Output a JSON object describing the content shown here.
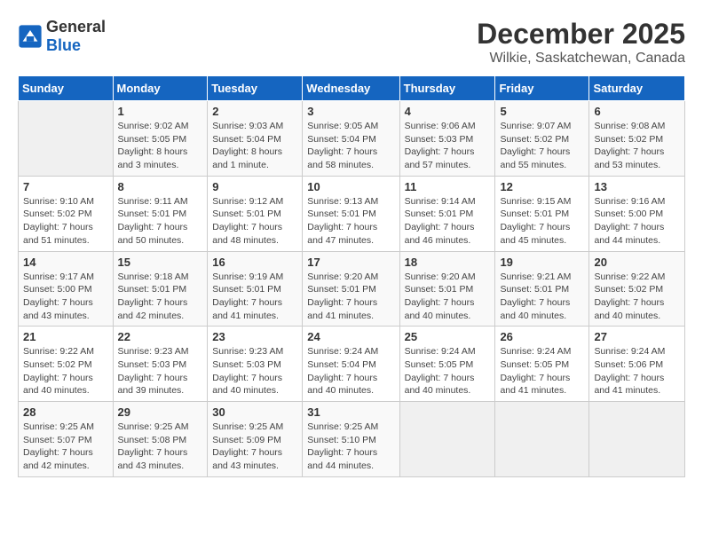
{
  "header": {
    "logo_general": "General",
    "logo_blue": "Blue",
    "month": "December 2025",
    "location": "Wilkie, Saskatchewan, Canada"
  },
  "days_of_week": [
    "Sunday",
    "Monday",
    "Tuesday",
    "Wednesday",
    "Thursday",
    "Friday",
    "Saturday"
  ],
  "weeks": [
    [
      {
        "day": "",
        "info": ""
      },
      {
        "day": "1",
        "info": "Sunrise: 9:02 AM\nSunset: 5:05 PM\nDaylight: 8 hours\nand 3 minutes."
      },
      {
        "day": "2",
        "info": "Sunrise: 9:03 AM\nSunset: 5:04 PM\nDaylight: 8 hours\nand 1 minute."
      },
      {
        "day": "3",
        "info": "Sunrise: 9:05 AM\nSunset: 5:04 PM\nDaylight: 7 hours\nand 58 minutes."
      },
      {
        "day": "4",
        "info": "Sunrise: 9:06 AM\nSunset: 5:03 PM\nDaylight: 7 hours\nand 57 minutes."
      },
      {
        "day": "5",
        "info": "Sunrise: 9:07 AM\nSunset: 5:02 PM\nDaylight: 7 hours\nand 55 minutes."
      },
      {
        "day": "6",
        "info": "Sunrise: 9:08 AM\nSunset: 5:02 PM\nDaylight: 7 hours\nand 53 minutes."
      }
    ],
    [
      {
        "day": "7",
        "info": "Sunrise: 9:10 AM\nSunset: 5:02 PM\nDaylight: 7 hours\nand 51 minutes."
      },
      {
        "day": "8",
        "info": "Sunrise: 9:11 AM\nSunset: 5:01 PM\nDaylight: 7 hours\nand 50 minutes."
      },
      {
        "day": "9",
        "info": "Sunrise: 9:12 AM\nSunset: 5:01 PM\nDaylight: 7 hours\nand 48 minutes."
      },
      {
        "day": "10",
        "info": "Sunrise: 9:13 AM\nSunset: 5:01 PM\nDaylight: 7 hours\nand 47 minutes."
      },
      {
        "day": "11",
        "info": "Sunrise: 9:14 AM\nSunset: 5:01 PM\nDaylight: 7 hours\nand 46 minutes."
      },
      {
        "day": "12",
        "info": "Sunrise: 9:15 AM\nSunset: 5:01 PM\nDaylight: 7 hours\nand 45 minutes."
      },
      {
        "day": "13",
        "info": "Sunrise: 9:16 AM\nSunset: 5:00 PM\nDaylight: 7 hours\nand 44 minutes."
      }
    ],
    [
      {
        "day": "14",
        "info": "Sunrise: 9:17 AM\nSunset: 5:00 PM\nDaylight: 7 hours\nand 43 minutes."
      },
      {
        "day": "15",
        "info": "Sunrise: 9:18 AM\nSunset: 5:01 PM\nDaylight: 7 hours\nand 42 minutes."
      },
      {
        "day": "16",
        "info": "Sunrise: 9:19 AM\nSunset: 5:01 PM\nDaylight: 7 hours\nand 41 minutes."
      },
      {
        "day": "17",
        "info": "Sunrise: 9:20 AM\nSunset: 5:01 PM\nDaylight: 7 hours\nand 41 minutes."
      },
      {
        "day": "18",
        "info": "Sunrise: 9:20 AM\nSunset: 5:01 PM\nDaylight: 7 hours\nand 40 minutes."
      },
      {
        "day": "19",
        "info": "Sunrise: 9:21 AM\nSunset: 5:01 PM\nDaylight: 7 hours\nand 40 minutes."
      },
      {
        "day": "20",
        "info": "Sunrise: 9:22 AM\nSunset: 5:02 PM\nDaylight: 7 hours\nand 40 minutes."
      }
    ],
    [
      {
        "day": "21",
        "info": "Sunrise: 9:22 AM\nSunset: 5:02 PM\nDaylight: 7 hours\nand 40 minutes."
      },
      {
        "day": "22",
        "info": "Sunrise: 9:23 AM\nSunset: 5:03 PM\nDaylight: 7 hours\nand 39 minutes."
      },
      {
        "day": "23",
        "info": "Sunrise: 9:23 AM\nSunset: 5:03 PM\nDaylight: 7 hours\nand 40 minutes."
      },
      {
        "day": "24",
        "info": "Sunrise: 9:24 AM\nSunset: 5:04 PM\nDaylight: 7 hours\nand 40 minutes."
      },
      {
        "day": "25",
        "info": "Sunrise: 9:24 AM\nSunset: 5:05 PM\nDaylight: 7 hours\nand 40 minutes."
      },
      {
        "day": "26",
        "info": "Sunrise: 9:24 AM\nSunset: 5:05 PM\nDaylight: 7 hours\nand 41 minutes."
      },
      {
        "day": "27",
        "info": "Sunrise: 9:24 AM\nSunset: 5:06 PM\nDaylight: 7 hours\nand 41 minutes."
      }
    ],
    [
      {
        "day": "28",
        "info": "Sunrise: 9:25 AM\nSunset: 5:07 PM\nDaylight: 7 hours\nand 42 minutes."
      },
      {
        "day": "29",
        "info": "Sunrise: 9:25 AM\nSunset: 5:08 PM\nDaylight: 7 hours\nand 43 minutes."
      },
      {
        "day": "30",
        "info": "Sunrise: 9:25 AM\nSunset: 5:09 PM\nDaylight: 7 hours\nand 43 minutes."
      },
      {
        "day": "31",
        "info": "Sunrise: 9:25 AM\nSunset: 5:10 PM\nDaylight: 7 hours\nand 44 minutes."
      },
      {
        "day": "",
        "info": ""
      },
      {
        "day": "",
        "info": ""
      },
      {
        "day": "",
        "info": ""
      }
    ]
  ]
}
